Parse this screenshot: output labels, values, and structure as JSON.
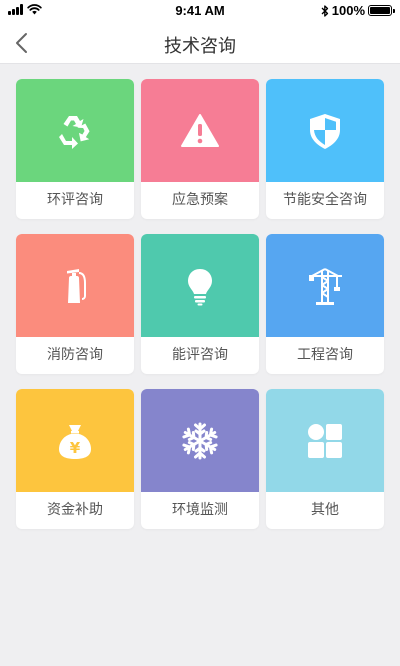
{
  "status_bar": {
    "time": "9:41 AM",
    "battery": "100%"
  },
  "nav": {
    "title": "技术咨询"
  },
  "cards": [
    {
      "label": "环评咨询",
      "color": "#6bd67d",
      "icon": "recycle-icon"
    },
    {
      "label": "应急预案",
      "color": "#f67d95",
      "icon": "warning-icon"
    },
    {
      "label": "节能安全咨询",
      "color": "#4fc0fa",
      "icon": "shield-icon"
    },
    {
      "label": "消防咨询",
      "color": "#fb8c7d",
      "icon": "fire-extinguisher-icon"
    },
    {
      "label": "能评咨询",
      "color": "#4fc9ad",
      "icon": "lightbulb-icon"
    },
    {
      "label": "工程咨询",
      "color": "#56a6f1",
      "icon": "crane-icon"
    },
    {
      "label": "资金补助",
      "color": "#fdc53e",
      "icon": "money-bag-icon"
    },
    {
      "label": "环境监测",
      "color": "#8585cc",
      "icon": "snowflake-icon"
    },
    {
      "label": "其他",
      "color": "#92d8e8",
      "icon": "grid-icon"
    }
  ]
}
